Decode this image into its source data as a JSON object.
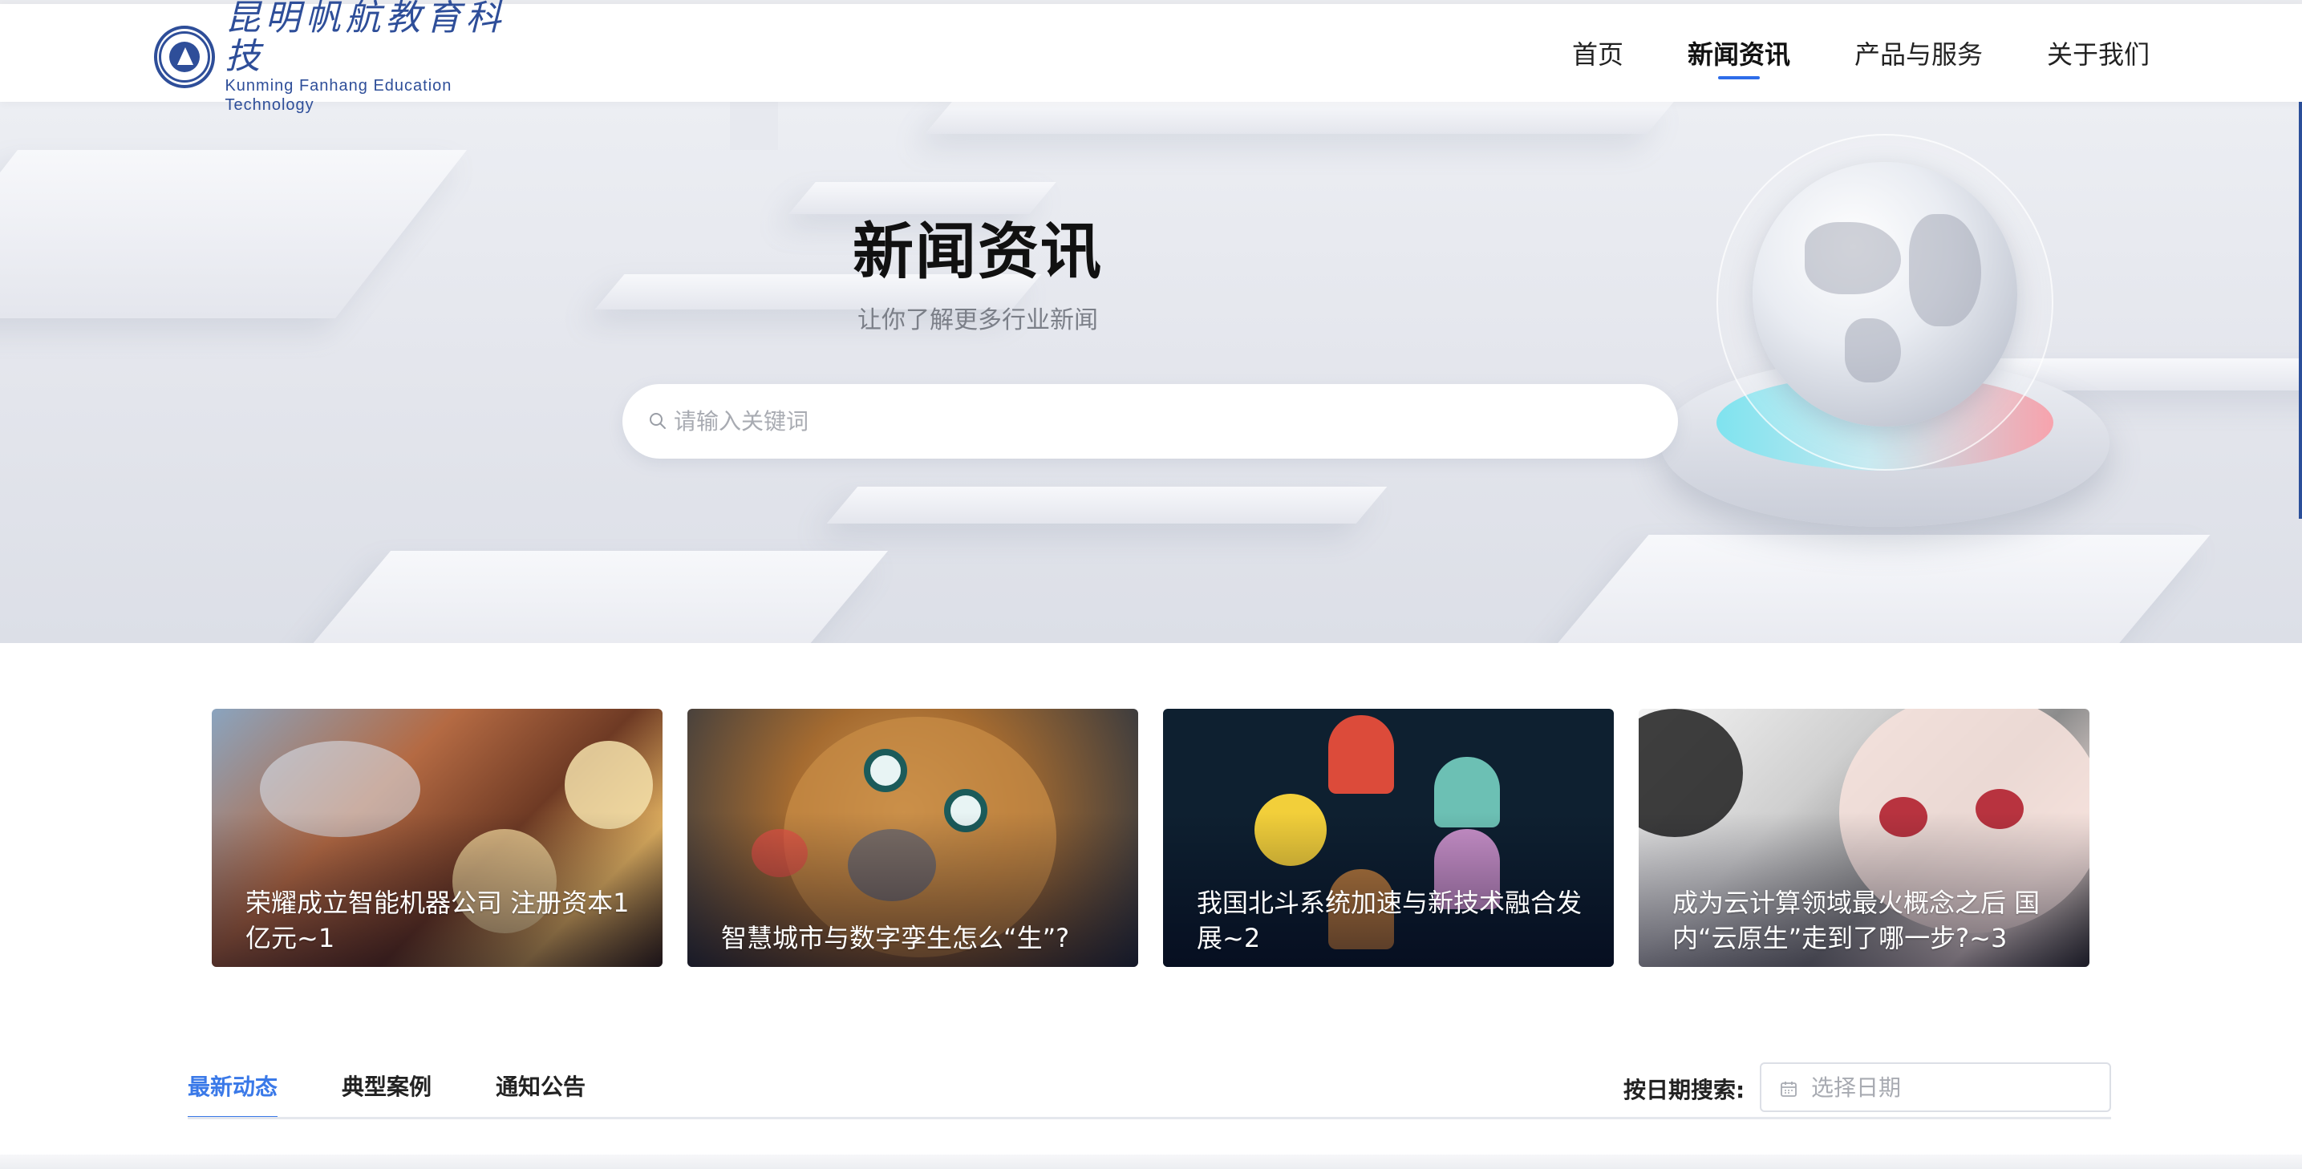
{
  "header": {
    "logo_cn": "昆明帆航教育科技",
    "logo_en": "Kunming Fanhang Education Technology",
    "nav": [
      {
        "label": "首页",
        "active": false
      },
      {
        "label": "新闻资讯",
        "active": true
      },
      {
        "label": "产品与服务",
        "active": false
      },
      {
        "label": "关于我们",
        "active": false
      }
    ]
  },
  "hero": {
    "title": "新闻资讯",
    "subtitle": "让你了解更多行业新闻",
    "search": {
      "placeholder": "请输入关键词",
      "value": "",
      "icon": "search-icon"
    }
  },
  "cards": [
    {
      "title": "荣耀成立智能机器公司 注册资本1亿元~1"
    },
    {
      "title": "智慧城市与数字孪生怎么“生”?"
    },
    {
      "title": "我国北斗系统加速与新技术融合发展~2"
    },
    {
      "title": "成为云计算领域最火概念之后 国内“云原生”走到了哪一步?~3"
    }
  ],
  "tabs": [
    {
      "label": "最新动态",
      "active": true
    },
    {
      "label": "典型案例",
      "active": false
    },
    {
      "label": "通知公告",
      "active": false
    }
  ],
  "date_filter": {
    "label": "按日期搜索:",
    "placeholder": "选择日期",
    "icon": "calendar-icon"
  },
  "colors": {
    "accent": "#3a79e8",
    "nav_underline": "#2d6ce9",
    "brand": "#2e4e99"
  }
}
